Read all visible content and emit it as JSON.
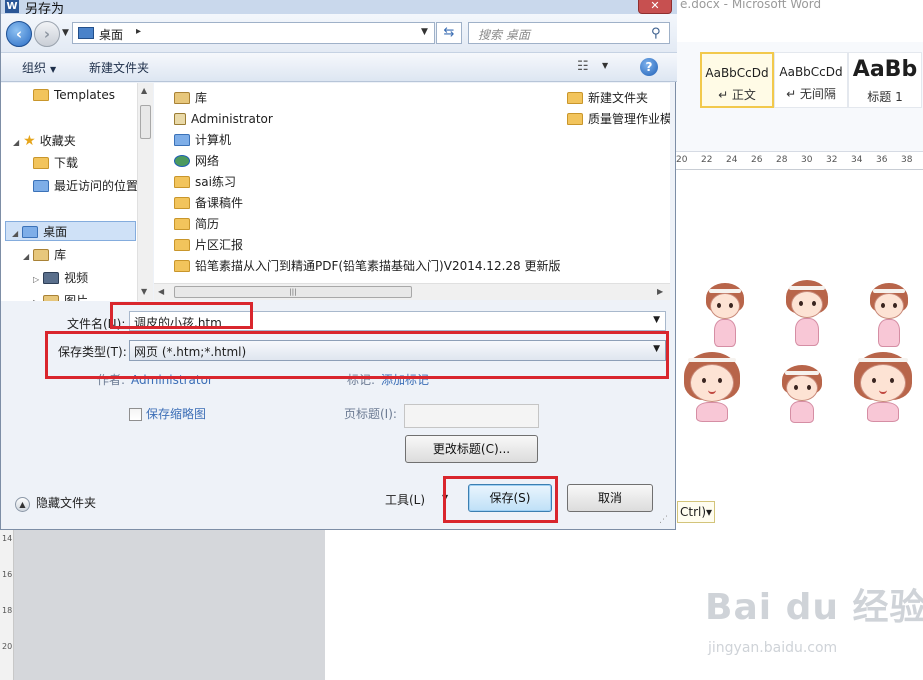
{
  "word": {
    "window_title": "e.docx - Microsoft Word",
    "styles": [
      {
        "sample": "AaBbCcDd",
        "name": "↵ 正文"
      },
      {
        "sample": "AaBbCcDd",
        "name": "↵ 无间隔"
      },
      {
        "sample": "AaBb",
        "name": "标题 1"
      }
    ],
    "ruler_ticks": [
      "20",
      "22",
      "24",
      "26",
      "28",
      "30",
      "32",
      "34",
      "36",
      "38"
    ],
    "vruler_ticks": [
      "14",
      "16",
      "18",
      "20"
    ],
    "paste_options": "Ctrl)▾",
    "watermark": "Bai du 经验",
    "watermark_sub": "jingyan.baidu.com"
  },
  "dialog": {
    "title": "另存为",
    "close": "✕",
    "address": {
      "location": "桌面",
      "separator": "▸"
    },
    "search": {
      "placeholder": "搜索 桌面"
    },
    "toolbar": {
      "organize": "组织",
      "new_folder": "新建文件夹"
    },
    "nav_pane": [
      {
        "label": "Templates",
        "icon": "folder-icon"
      },
      {
        "label": "收藏夹",
        "icon": "star-icon"
      },
      {
        "label": "下载",
        "icon": "download-folder-icon"
      },
      {
        "label": "最近访问的位置",
        "icon": "recent-places-icon"
      },
      {
        "label": "桌面",
        "icon": "desktop-icon"
      },
      {
        "label": "库",
        "icon": "library-icon"
      },
      {
        "label": "视频",
        "icon": "video-icon"
      },
      {
        "label": "图片",
        "icon": "pictures-icon"
      }
    ],
    "files_left": [
      {
        "name": "库",
        "icon": "library-icon"
      },
      {
        "name": "Administrator",
        "icon": "user-icon"
      },
      {
        "name": "计算机",
        "icon": "computer-icon"
      },
      {
        "name": "网络",
        "icon": "network-icon"
      },
      {
        "name": "sai练习",
        "icon": "folder-icon"
      },
      {
        "name": "备课稿件",
        "icon": "folder-icon"
      },
      {
        "name": "简历",
        "icon": "folder-icon"
      },
      {
        "name": "片区汇报",
        "icon": "folder-icon"
      },
      {
        "name": "铅笔素描从入门到精通PDF(铅笔素描基础入门)V2014.12.28 更新版",
        "icon": "folder-icon"
      }
    ],
    "files_right": [
      {
        "name": "新建文件夹",
        "icon": "folder-icon"
      },
      {
        "name": "质量管理作业模",
        "icon": "folder-icon"
      }
    ],
    "filename": {
      "label": "文件名(N):",
      "value": "调皮的小孩.htm"
    },
    "filetype": {
      "label": "保存类型(T):",
      "value": "网页 (*.htm;*.html)"
    },
    "author": {
      "label": "作者:",
      "value": "Administrator"
    },
    "tags": {
      "label": "标记:",
      "value": "添加标记"
    },
    "save_thumbnail": "保存缩略图",
    "page_title": {
      "label": "页标题(I):",
      "value": ""
    },
    "change_title": "更改标题(C)...",
    "hide_folders": "隐藏文件夹",
    "tools": "工具(L)",
    "save": "保存(S)",
    "cancel": "取消"
  },
  "colors": {
    "highlight": "#d9262d",
    "link": "#3d6fb7",
    "accent": "#2b5797"
  }
}
